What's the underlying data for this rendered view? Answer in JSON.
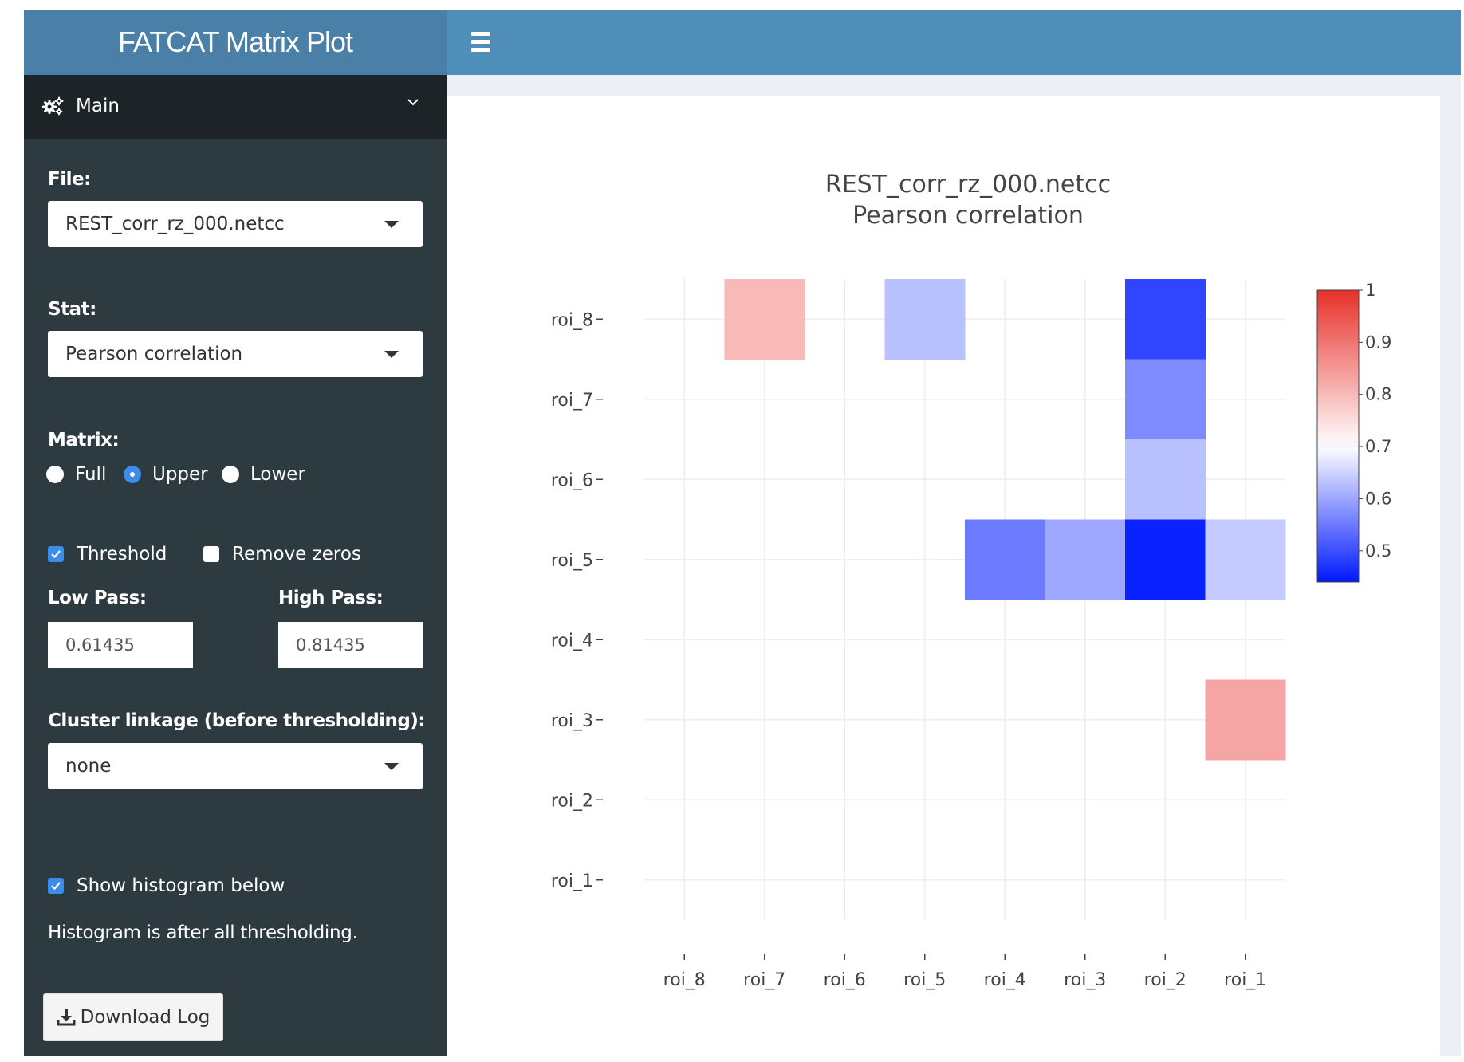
{
  "app": {
    "title": "FATCAT Matrix Plot"
  },
  "sidebar": {
    "menu_label": "Main",
    "file": {
      "label": "File:",
      "value": "REST_corr_rz_000.netcc"
    },
    "stat": {
      "label": "Stat:",
      "value": "Pearson correlation"
    },
    "matrix": {
      "label": "Matrix:",
      "options": [
        {
          "label": "Full",
          "selected": false
        },
        {
          "label": "Upper",
          "selected": true
        },
        {
          "label": "Lower",
          "selected": false
        }
      ]
    },
    "threshold": {
      "label": "Threshold",
      "checked": true
    },
    "remove_zeros": {
      "label": "Remove zeros",
      "checked": false
    },
    "low_pass": {
      "label": "Low Pass:",
      "value": "0.61435"
    },
    "high_pass": {
      "label": "High Pass:",
      "value": "0.81435"
    },
    "cluster": {
      "label": "Cluster linkage (before thresholding):",
      "value": "none"
    },
    "show_histogram": {
      "label": "Show histogram below",
      "checked": true
    },
    "histogram_note": "Histogram is after all thresholding.",
    "download_label": "Download Log"
  },
  "icons": [
    "gears-icon",
    "chevron-down-icon",
    "hamburger-icon",
    "download-icon"
  ],
  "colors": {
    "header": "#4f8eb9",
    "logo_bg": "#4a7fa8",
    "sidebar": "#2d3a40",
    "accent": "#3c8de9"
  },
  "chart_data": {
    "type": "heatmap",
    "title": "REST_corr_rz_000.netcc",
    "subtitle": "Pearson correlation",
    "x_categories": [
      "roi_8",
      "roi_7",
      "roi_6",
      "roi_5",
      "roi_4",
      "roi_3",
      "roi_2",
      "roi_1"
    ],
    "y_categories": [
      "roi_8",
      "roi_7",
      "roi_6",
      "roi_5",
      "roi_4",
      "roi_3",
      "roi_2",
      "roi_1"
    ],
    "colorscale": {
      "min": 0.44,
      "max": 1.0,
      "low_color": "#0019ff",
      "mid_color": "#ffffff",
      "high_color": "#e8302a",
      "mid_value": 0.7
    },
    "colorbar_ticks": [
      "1",
      "0.9",
      "0.8",
      "0.7",
      "0.6",
      "0.5"
    ],
    "colorbar_tick_values": [
      1,
      0.9,
      0.8,
      0.7,
      0.6,
      0.5
    ],
    "cells": [
      {
        "x": "roi_7",
        "y": "roi_8",
        "value": 0.8
      },
      {
        "x": "roi_5",
        "y": "roi_8",
        "value": 0.63
      },
      {
        "x": "roi_2",
        "y": "roi_8",
        "value": 0.49
      },
      {
        "x": "roi_2",
        "y": "roi_7",
        "value": 0.57
      },
      {
        "x": "roi_2",
        "y": "roi_6",
        "value": 0.63
      },
      {
        "x": "roi_4",
        "y": "roi_5",
        "value": 0.55
      },
      {
        "x": "roi_3",
        "y": "roi_5",
        "value": 0.6
      },
      {
        "x": "roi_2",
        "y": "roi_5",
        "value": 0.45
      },
      {
        "x": "roi_1",
        "y": "roi_5",
        "value": 0.64
      },
      {
        "x": "roi_1",
        "y": "roi_3",
        "value": 0.83
      }
    ],
    "grid": true
  }
}
